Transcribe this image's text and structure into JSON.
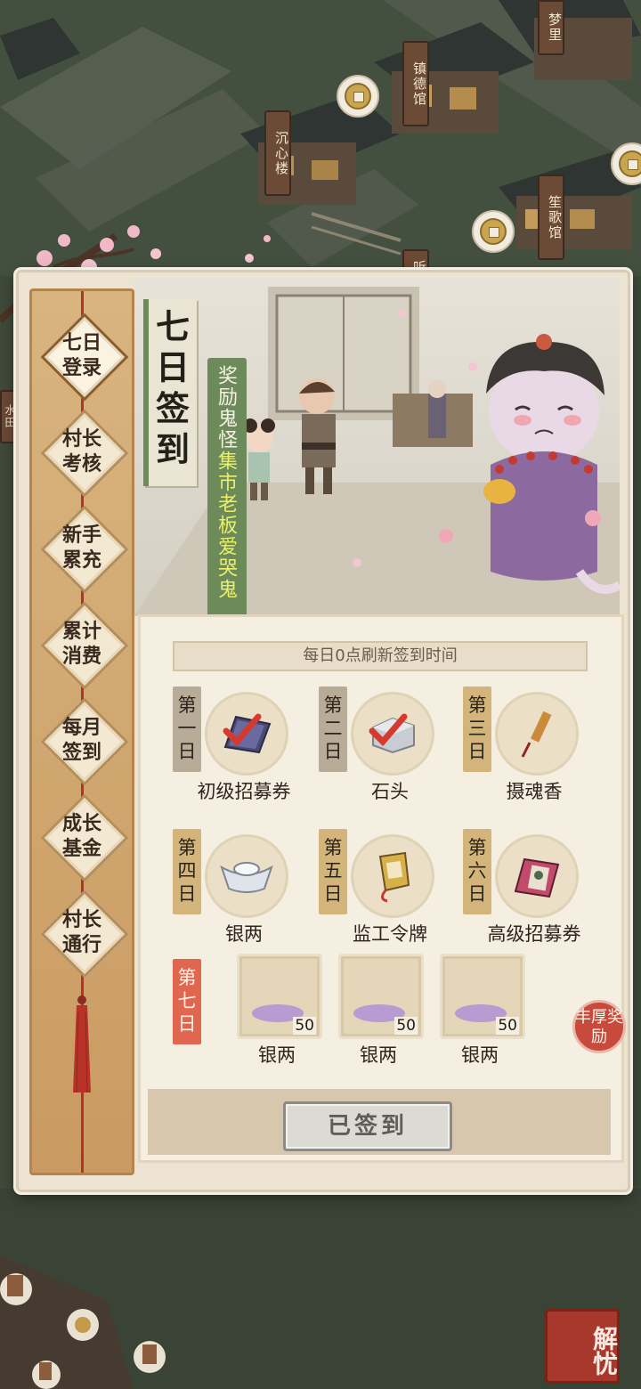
{
  "map": {
    "signs": [
      "沉心楼",
      "镇德馆",
      "梦里",
      "笙歌馆",
      "听",
      "水田"
    ]
  },
  "panel": {
    "banner": {
      "title": "七日签到",
      "subtitle_prefix": "奖励鬼怪",
      "subtitle_highlight": "集市老板爱哭鬼"
    },
    "sidebar_tabs": [
      {
        "label": "七日\n登录",
        "active": true
      },
      {
        "label": "村长\n考核",
        "active": false
      },
      {
        "label": "新手\n累充",
        "active": false
      },
      {
        "label": "累计\n消费",
        "active": false
      },
      {
        "label": "每月\n签到",
        "active": false
      },
      {
        "label": "成长\n基金",
        "active": false
      },
      {
        "label": "村长\n通行",
        "active": false
      }
    ],
    "refresh_notice": "每日0点刷新签到时间",
    "days": [
      {
        "tag": "第一日",
        "item": "初级招募券",
        "icon": "ticket-icon",
        "claimed": true
      },
      {
        "tag": "第二日",
        "item": "石头",
        "icon": "stone-icon",
        "claimed": true
      },
      {
        "tag": "第三日",
        "item": "摄魂香",
        "icon": "incense-icon",
        "claimed": false
      },
      {
        "tag": "第四日",
        "item": "银两",
        "icon": "silver-ingot-icon",
        "claimed": false
      },
      {
        "tag": "第五日",
        "item": "监工令牌",
        "icon": "token-icon",
        "claimed": false
      },
      {
        "tag": "第六日",
        "item": "高级招募券",
        "icon": "premium-ticket-icon",
        "claimed": false
      }
    ],
    "day7": {
      "tag": "第七日",
      "rewards": [
        {
          "item": "银两",
          "count": "50"
        },
        {
          "item": "银两",
          "count": "50"
        },
        {
          "item": "银两",
          "count": "50"
        }
      ],
      "bonus_badge": "丰厚奖励"
    },
    "sign_button": "已签到"
  },
  "corner_seal": "解忧",
  "colors": {
    "accent_green": "#6d8a5a",
    "accent_red": "#c84a3c",
    "highlight_yellow": "#e9f06a"
  }
}
